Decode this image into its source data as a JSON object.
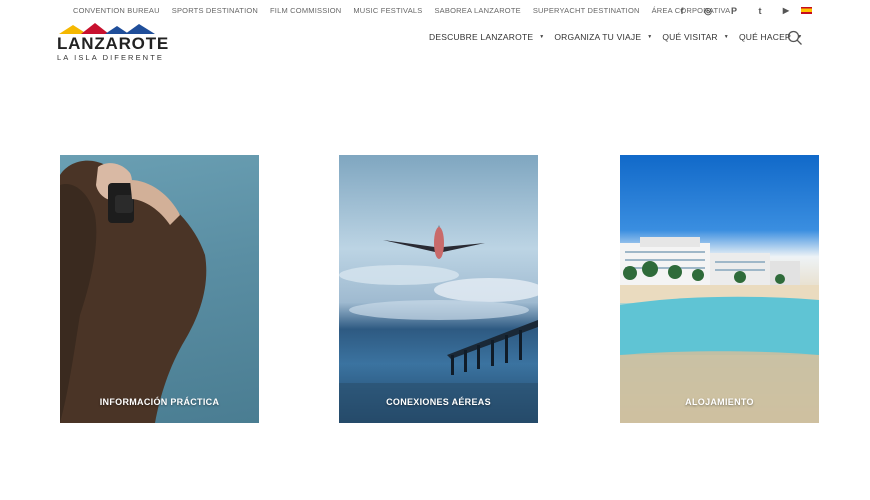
{
  "top_links": [
    {
      "label": "CONVENTION BUREAU"
    },
    {
      "label": "SPORTS DESTINATION"
    },
    {
      "label": "FILM COMMISSION"
    },
    {
      "label": "MUSIC FESTIVALS"
    },
    {
      "label": "SABOREA LANZAROTE"
    },
    {
      "label": "SUPERYACHT DESTINATION"
    },
    {
      "label": "ÁREA CORPORATIVA"
    }
  ],
  "socials": [
    {
      "icon": "facebook-icon",
      "glyph": "f"
    },
    {
      "icon": "instagram-icon",
      "glyph": "◎"
    },
    {
      "icon": "pinterest-icon",
      "glyph": "P"
    },
    {
      "icon": "twitter-icon",
      "glyph": "t"
    },
    {
      "icon": "youtube-icon",
      "glyph": "▶"
    }
  ],
  "language_flag": {
    "icon": "spain-flag-icon"
  },
  "logo": {
    "name": "LANZAROTE",
    "tagline": "LA ISLA DIFERENTE"
  },
  "nav": [
    {
      "label": "DESCUBRE LANZAROTE"
    },
    {
      "label": "ORGANIZA TU VIAJE"
    },
    {
      "label": "QUÉ VISITAR"
    },
    {
      "label": "QUÉ HACER"
    }
  ],
  "cards": [
    {
      "label": "INFORMACIÓN PRÁCTICA"
    },
    {
      "label": "CONEXIONES AÉREAS"
    },
    {
      "label": "ALOJAMIENTO"
    }
  ],
  "colors": {
    "accent_red": "#c8102e",
    "accent_yellow": "#f5b800",
    "accent_blue": "#1f4e9a"
  }
}
